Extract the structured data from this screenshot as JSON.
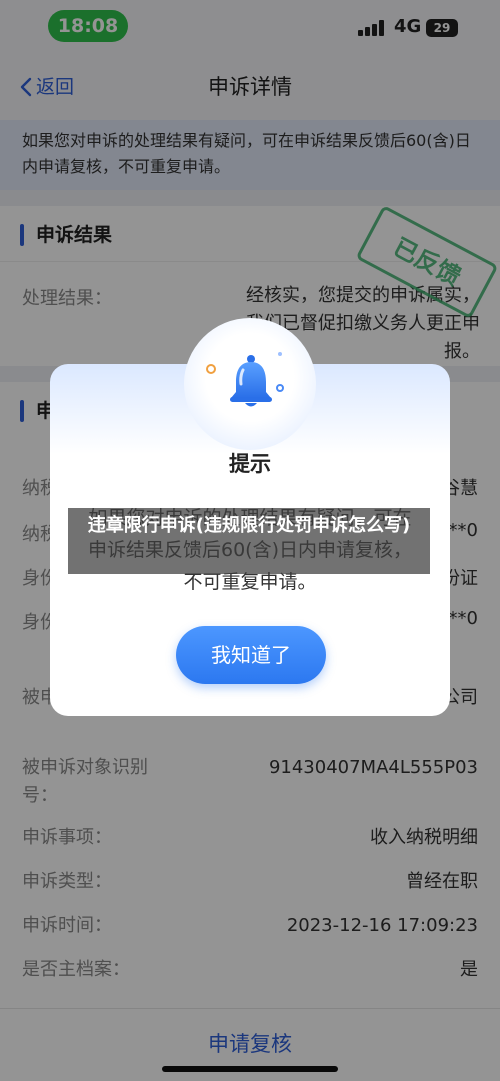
{
  "status_bar": {
    "time": "18:08",
    "network": "4G",
    "battery": "29"
  },
  "nav": {
    "back_label": "返回",
    "title": "申诉详情"
  },
  "notice": {
    "text": "如果您对申诉的处理结果有疑问，可在申诉结果反馈后60(含)日内申请复核，不可重复申请。"
  },
  "result_section": {
    "title": "申诉结果",
    "label": "处理结果：",
    "text": "经核实，您提交的申诉属实，我们已督促扣缴义务人更正申报。",
    "stamp": "已反馈"
  },
  "info_section": {
    "title": "申",
    "rows": [
      {
        "label": "纳税",
        "value": "谷慧"
      },
      {
        "label": "纳税",
        "value": "**0"
      },
      {
        "label": "身份",
        "value": "份证"
      },
      {
        "label": "身份",
        "value": "**0"
      }
    ]
  },
  "details": [
    {
      "label": "被申",
      "value": "理有限公司"
    },
    {
      "label": "被申诉对象识别号：",
      "value": "91430407MA4L555P03"
    },
    {
      "label": "申诉事项：",
      "value": "收入纳税明细"
    },
    {
      "label": "申诉类型：",
      "value": "曾经在职"
    },
    {
      "label": "申诉时间：",
      "value": "2023-12-16 17:09:23"
    },
    {
      "label": "是否主档案：",
      "value": "是"
    }
  ],
  "bottom": {
    "button_label": "申请复核"
  },
  "dialog": {
    "title": "提示",
    "message": "如果您对申诉的处理结果有疑问，可在申诉结果反馈后60(含)日内申请复核，不可重复申请。",
    "ok_label": "我知道了",
    "icon": "bell-icon"
  },
  "caption": {
    "text": "违章限行申诉(违规限行处罚申诉怎么写)"
  },
  "colors": {
    "accent": "#2f5fd8",
    "button": "#2c78f0",
    "stamp": "#3cae6c",
    "status_green": "#2fc24c"
  }
}
